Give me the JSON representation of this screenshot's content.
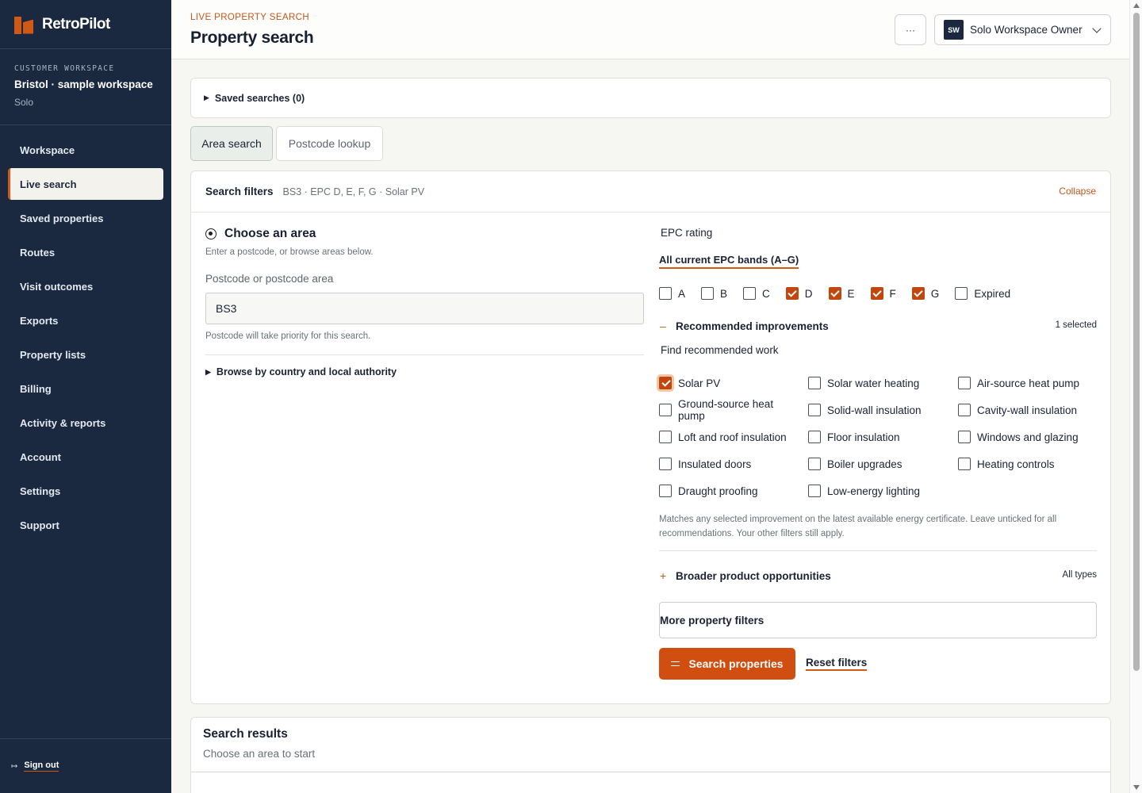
{
  "brand": {
    "name": "RetroPilot"
  },
  "workspace": {
    "kicker": "CUSTOMER WORKSPACE",
    "name": "Bristol · sample workspace",
    "plan": "Solo"
  },
  "nav": [
    {
      "label": "Workspace",
      "active": false
    },
    {
      "label": "Live search",
      "active": true
    },
    {
      "label": "Saved properties",
      "active": false
    },
    {
      "label": "Routes",
      "active": false
    },
    {
      "label": "Visit outcomes",
      "active": false
    },
    {
      "label": "Exports",
      "active": false
    },
    {
      "label": "Property lists",
      "active": false
    },
    {
      "label": "Billing",
      "active": false
    },
    {
      "label": "Activity & reports",
      "active": false
    },
    {
      "label": "Account",
      "active": false
    },
    {
      "label": "Settings",
      "active": false
    },
    {
      "label": "Support",
      "active": false
    }
  ],
  "signout": {
    "label": "Sign out",
    "icon": "sign-out-icon"
  },
  "header": {
    "kicker": "LIVE PROPERTY SEARCH",
    "title": "Property search",
    "more_label": "···",
    "user": {
      "initials": "SW",
      "name": "Solo Workspace Owner"
    }
  },
  "saved_searches": {
    "label": "Saved searches (0)"
  },
  "tabs": [
    {
      "label": "Area search",
      "active": true
    },
    {
      "label": "Postcode lookup",
      "active": false
    }
  ],
  "filters": {
    "title": "Search filters",
    "summary": "BS3 · EPC D, E, F, G · Solar PV",
    "collapse": "Collapse",
    "area": {
      "title": "Choose an area",
      "subtitle": "Enter a postcode, or browse areas below.",
      "postcode_label": "Postcode or postcode area",
      "postcode_value": "BS3",
      "postcode_help": "Postcode will take priority for this search.",
      "browse_label": "Browse by country and local authority"
    },
    "epc": {
      "label": "EPC rating",
      "all_label": "All current EPC bands (A–G)",
      "bands": [
        {
          "label": "A",
          "checked": false
        },
        {
          "label": "B",
          "checked": false
        },
        {
          "label": "C",
          "checked": false
        },
        {
          "label": "D",
          "checked": true
        },
        {
          "label": "E",
          "checked": true
        },
        {
          "label": "F",
          "checked": true
        },
        {
          "label": "G",
          "checked": true
        },
        {
          "label": "Expired",
          "checked": false
        }
      ]
    },
    "improvements": {
      "sign": "–",
      "title": "Recommended improvements",
      "count": "1 selected",
      "find_label": "Find recommended work",
      "items": [
        {
          "label": "Solar PV",
          "checked": true
        },
        {
          "label": "Solar water heating",
          "checked": false
        },
        {
          "label": "Air-source heat pump",
          "checked": false
        },
        {
          "label": "Ground-source heat pump",
          "checked": false
        },
        {
          "label": "Solid-wall insulation",
          "checked": false
        },
        {
          "label": "Cavity-wall insulation",
          "checked": false
        },
        {
          "label": "Loft and roof insulation",
          "checked": false
        },
        {
          "label": "Floor insulation",
          "checked": false
        },
        {
          "label": "Windows and glazing",
          "checked": false
        },
        {
          "label": "Insulated doors",
          "checked": false
        },
        {
          "label": "Boiler upgrades",
          "checked": false
        },
        {
          "label": "Heating controls",
          "checked": false
        },
        {
          "label": "Draught proofing",
          "checked": false
        },
        {
          "label": "Low-energy lighting",
          "checked": false
        }
      ],
      "note": "Matches any selected improvement on the latest available energy certificate. Leave unticked for all recommendations. Your other filters still apply."
    },
    "broader": {
      "sign": "+",
      "title": "Broader product opportunities",
      "value": "All types"
    },
    "more_filters": "More property filters",
    "search_button": "Search properties",
    "reset_button": "Reset filters"
  },
  "results": {
    "title": "Search results",
    "subtitle": "Choose an area to start"
  },
  "colors": {
    "accent": "#d05a14",
    "sidebar": "#1b2940",
    "checked": "#c2470f"
  }
}
